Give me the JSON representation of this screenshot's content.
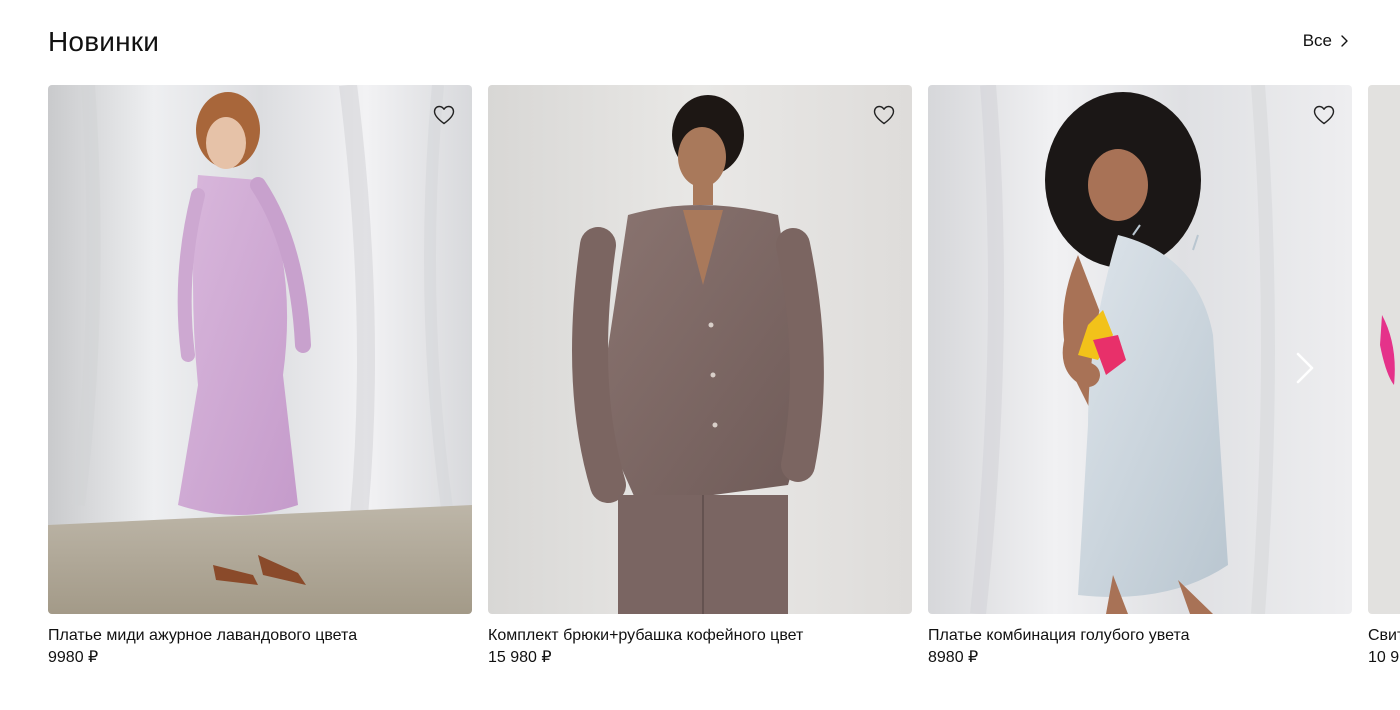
{
  "section": {
    "title": "Новинки",
    "all_label": "Все"
  },
  "products": [
    {
      "name": "Платье миди ажурное лавандового цвета",
      "price": "9980 ₽"
    },
    {
      "name": "Комплект брюки+рубашка кофейного цвет",
      "price": "15 980 ₽"
    },
    {
      "name": "Платье комбинация голубого увета",
      "price": "8980 ₽"
    },
    {
      "name": "Свит",
      "price": "10 9"
    }
  ],
  "icons": {
    "favorite": "heart-outline-icon",
    "next": "chevron-right-icon",
    "all_arrow": "chevron-right-icon"
  },
  "colors": {
    "text": "#111111",
    "background": "#ffffff",
    "icon_light": "#ffffff"
  }
}
